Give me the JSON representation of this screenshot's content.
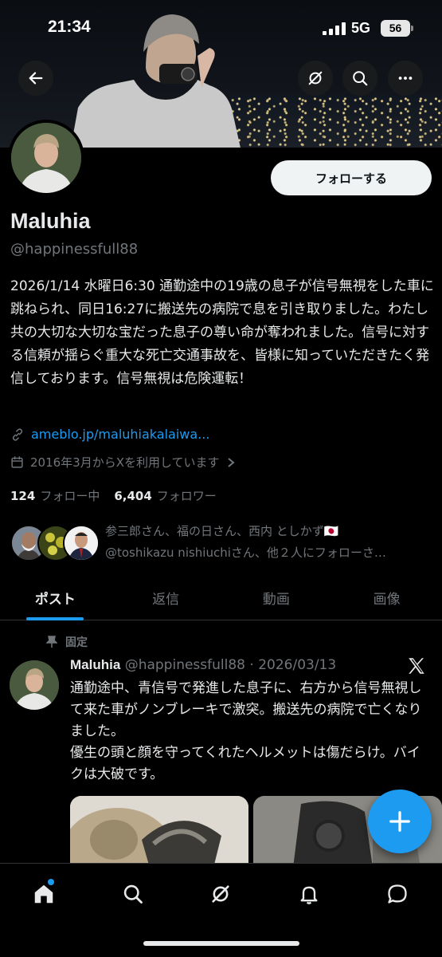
{
  "status_bar": {
    "time": "21:34",
    "network": "5G",
    "battery": "56"
  },
  "header": {
    "back_icon": "arrow-left-icon",
    "grok_icon": "grok-icon",
    "search_icon": "search-icon",
    "more_icon": "more-dots-icon"
  },
  "profile": {
    "name": "Maluhia",
    "handle": "@happinessfull88",
    "follow_label": "フォローする",
    "bio": "2026/1/14 水曜日6:30 通勤途中の19歳の息子が信号無視をした車に跳ねられ、同日16:27に搬送先の病院で息を引き取りました。わたし共の大切な大切な宝だった息子の尊い命が奪われました。信号に対する信頼が揺らぐ重大な死亡交通事故を、皆様に知っていただきたく発信しております。信号無視は危険運転！",
    "link": "ameblo.jp/maluhiakalaiwa...",
    "joined": "2016年3月からXを利用しています",
    "following_count": "124",
    "following_label": "フォロー中",
    "followers_count": "6,404",
    "followers_label": "フォロワー",
    "followed_by_line1": "参三郎さん、福の日さん、西内 としかず🇯🇵",
    "followed_by_line2": "@toshikazu nishiuchiさん、他２人にフォローさ…"
  },
  "tabs": [
    {
      "label": "ポスト",
      "active": true
    },
    {
      "label": "返信",
      "active": false
    },
    {
      "label": "動画",
      "active": false
    },
    {
      "label": "画像",
      "active": false
    }
  ],
  "post": {
    "pinned_label": "固定",
    "author": "Maluhia",
    "meta": "@happinessfull88 · 2026/03/13",
    "text_line1": "通勤途中、青信号で発進した息子に、右方から信号無視して来た車がノンブレーキで激突。搬送先の病院で亡くなりました。",
    "text_line2": "優生の頭と顔を守ってくれたヘルメットは傷だらけ。バイクは大破です。"
  },
  "fab": {
    "icon": "plus-icon"
  },
  "bottom_nav": [
    "home-icon",
    "search-icon",
    "grok-icon",
    "notifications-bell-icon",
    "messages-icon"
  ],
  "colors": {
    "accent": "#1d9bf0",
    "text_primary": "#e7e9ea",
    "text_secondary": "#71767b",
    "background": "#000000"
  }
}
